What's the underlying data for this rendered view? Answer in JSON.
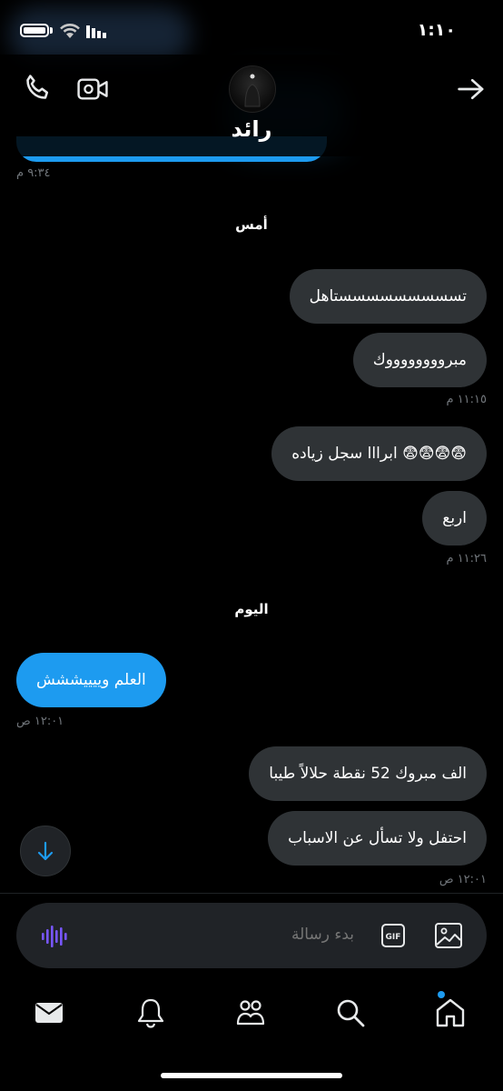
{
  "status_bar": {
    "time": "١:١٠"
  },
  "header": {
    "contact_name": "رائد"
  },
  "messages": {
    "prev_time": "٩:٣٤ م",
    "date_yesterday": "أمس",
    "m1": "تسسسسسسسسستاهل",
    "m2": "مبرووووووووك",
    "t1": "١١:١٥ م",
    "m3": "ابرااا سجل زياده 😨😨😨😨",
    "m4": "اربع",
    "t2": "١١:٢٦ م",
    "date_today": "اليوم",
    "m5": "العلم وييييششش",
    "t3": "١٢:٠١ ص",
    "m6": "الف مبروك 52 نقطة حلالاً طيبا",
    "m7": "احتفل ولا تسأل عن الاسباب",
    "t4": "١٢:٠١ ص"
  },
  "composer": {
    "placeholder": "بدء رسالة",
    "gif_label": "GIF"
  },
  "colors": {
    "accent": "#1d9bf0",
    "outgoing_bubble": "#2f3336",
    "voice_accent": "#7856ff",
    "background": "#000000"
  },
  "icons": [
    "phone-icon",
    "video-icon",
    "back-arrow-icon",
    "scroll-down-arrow-icon",
    "voice-waveform-icon",
    "gif-icon",
    "image-icon",
    "mail-icon",
    "bell-icon",
    "communities-icon",
    "search-icon",
    "home-icon"
  ]
}
